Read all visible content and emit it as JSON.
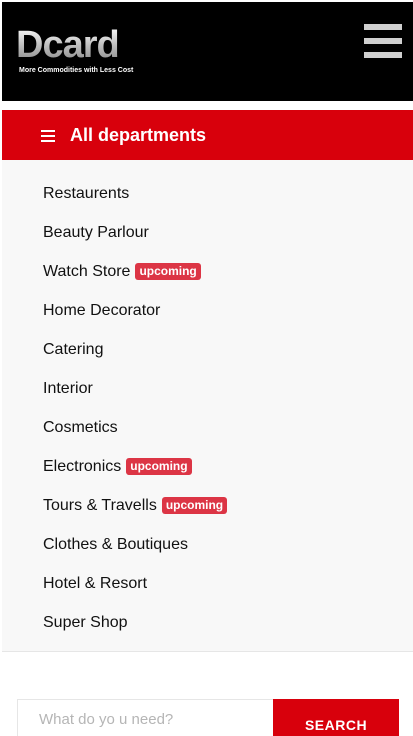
{
  "header": {
    "logo_text": "Dcard",
    "logo_tagline": "More Commodities with Less Cost",
    "menu_icon": "hamburger-icon"
  },
  "departments": {
    "title": "All departments",
    "icon": "list-icon",
    "accent_color": "#d8000c",
    "badge_color": "#dc3545",
    "items": [
      {
        "label": "Restaurents",
        "badge": ""
      },
      {
        "label": "Beauty Parlour",
        "badge": ""
      },
      {
        "label": "Watch Store",
        "badge": "upcoming"
      },
      {
        "label": "Home Decorator",
        "badge": ""
      },
      {
        "label": "Catering",
        "badge": ""
      },
      {
        "label": "Interior",
        "badge": ""
      },
      {
        "label": "Cosmetics",
        "badge": ""
      },
      {
        "label": "Electronics",
        "badge": "upcoming"
      },
      {
        "label": "Tours & Travells",
        "badge": "upcoming"
      },
      {
        "label": "Clothes & Boutiques",
        "badge": ""
      },
      {
        "label": "Hotel & Resort",
        "badge": ""
      },
      {
        "label": "Super Shop",
        "badge": ""
      }
    ]
  },
  "search": {
    "placeholder": "What do yo u need?",
    "value": "",
    "button_label": "SEARCH"
  }
}
